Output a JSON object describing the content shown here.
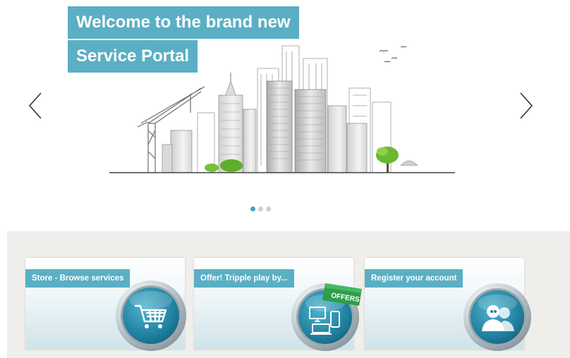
{
  "hero": {
    "title_line1": "Welcome to the brand new",
    "title_line2": "Service Portal",
    "accent_color": "#5aafc4",
    "active_dot_color": "#3aa6c6",
    "slide_count": 3,
    "active_slide": 1
  },
  "tiles": [
    {
      "label": "Store - Browse services",
      "icon": "shopping-cart-icon"
    },
    {
      "label": "Offer! Tripple play by...",
      "icon": "devices-icon",
      "badge": "OFFERS"
    },
    {
      "label": "Register your account",
      "icon": "user-pair-icon"
    }
  ]
}
